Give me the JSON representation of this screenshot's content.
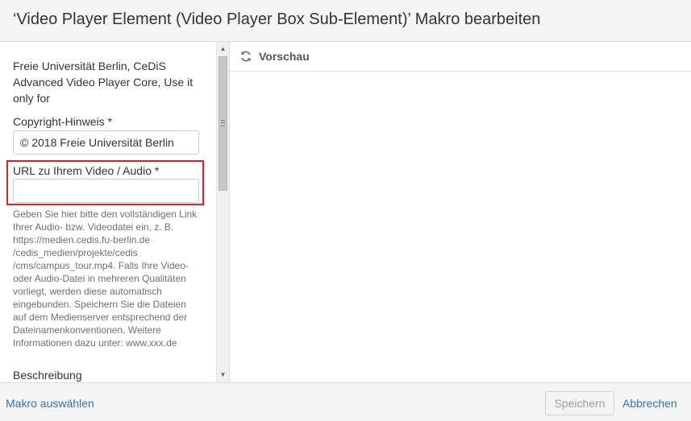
{
  "dialog": {
    "title": "‘Video Player Element (Video Player Box Sub-Element)’ Makro bearbeiten"
  },
  "form": {
    "intro_text": "Freie Universität Berlin, CeDiS Advanced Video Player Core, Use it only for",
    "copyright": {
      "label": "Copyright-Hinweis *",
      "value": "© 2018 Freie Universität Berlin"
    },
    "url": {
      "label": "URL zu Ihrem Video / Audio *",
      "value": "",
      "help_text": "Geben Sie hier bitte den vollständigen Link Ihrer Audio- bzw. Videodatei ein, z. B. https://medien.cedis.fu-berlin.de /cedis_medien/projekte/cedis /cms/campus_tour.mp4. Falls Ihre Video- oder Audio-Datei in mehreren Qualitäten vorliegt, werden diese automatisch eingebunden. Speichern Sie die Dateien auf dem Medienserver entsprechend der Dateinamenkonventionen. Weitere Informationen dazu unter: www.xxx.de"
    },
    "description": {
      "label": "Beschreibung"
    }
  },
  "preview": {
    "label": "Vorschau",
    "icon": "refresh-icon"
  },
  "footer": {
    "select_macro_link": "Makro auswählen",
    "save_label": "Speichern",
    "cancel_label": "Abbrechen"
  },
  "colors": {
    "link": "#3572b0",
    "highlight": "#d9232b",
    "header_bg": "#f5f5f5"
  }
}
